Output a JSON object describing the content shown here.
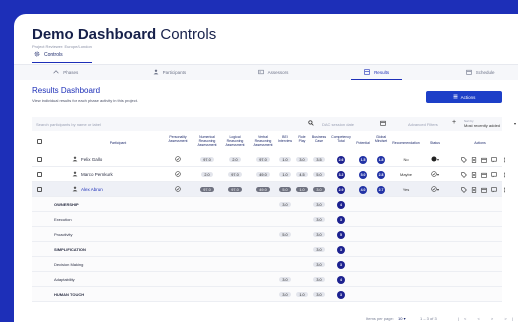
{
  "header": {
    "title": "Demo Dashboard",
    "subtitle": "Controls",
    "project": "Project Reviewer: Europe/London"
  },
  "controls_tab": {
    "label": "Controls",
    "icon": "gear-icon"
  },
  "tabs": [
    {
      "label": "Phases",
      "icon": "phases-icon"
    },
    {
      "label": "Participants",
      "icon": "person-icon"
    },
    {
      "label": "Assessors",
      "icon": "id-card-icon"
    },
    {
      "label": "Results",
      "icon": "results-icon",
      "active": true
    },
    {
      "label": "Schedule",
      "icon": "calendar-icon"
    }
  ],
  "results": {
    "title": "Results Dashboard",
    "description": "View individual results for each phase activity in this project.",
    "actions_label": "Actions"
  },
  "filters": {
    "search_placeholder": "Search participants by name or label",
    "session_placeholder": "DAC session date",
    "advanced_label": "Advanced Filters",
    "sort_label": "Sort by",
    "sort_value": "Most recently added"
  },
  "columns": {
    "participant": "Participant",
    "personality": "Personality Assessment",
    "numerical": "Numerical Reasoning Assessment",
    "logical": "Logical Reasoning Assessment",
    "verbal": "Verbal Reasoning Assessment",
    "bei": "BEI Interview",
    "role": "Role Play",
    "business": "Business Case",
    "competency": "Competency Total",
    "potential": "Potential",
    "global": "Global Mindset",
    "recommendation": "Recommendation",
    "status": "Status",
    "actions": "Actions"
  },
  "participants": [
    {
      "name": "Felix Gallo",
      "numerical": "97.0",
      "logical": "2.0",
      "verbal": "97.0",
      "bei": "1.0",
      "role": "3.0",
      "business": "3.5",
      "competency": "2.6",
      "potential": "1.5",
      "global": "1.8",
      "recommendation": "No"
    },
    {
      "name": "Marco Pernkurk",
      "numerical": "2.0",
      "logical": "97.0",
      "verbal": "49.0",
      "bei": "1.0",
      "role": "4.5",
      "business": "5.0",
      "competency": "3.2",
      "potential": "5.0",
      "global": "2.8",
      "recommendation": "Maybe"
    },
    {
      "name": "Alex Abrun",
      "numerical": "97.0",
      "logical": "97.0",
      "verbal": "49.0",
      "bei": "5.0",
      "role": "1.0",
      "business": "3.0",
      "competency": "2.9",
      "potential": "4.0",
      "global": "2.7",
      "recommendation": "Yes"
    }
  ],
  "subrows": [
    {
      "label": "OWNERSHIP",
      "bold": true,
      "bei": "3.0",
      "role": "",
      "business": "3.0",
      "competency": "4"
    },
    {
      "label": "Execution",
      "bold": false,
      "bei": "",
      "role": "",
      "business": "3.0",
      "competency": "3"
    },
    {
      "label": "Proactivity",
      "bold": false,
      "bei": "5.0",
      "role": "",
      "business": "3.0",
      "competency": "5"
    },
    {
      "label": "SIMPLIFICATION",
      "bold": true,
      "bei": "",
      "role": "",
      "business": "3.0",
      "competency": "3"
    },
    {
      "label": "Decision Making",
      "bold": false,
      "bei": "",
      "role": "",
      "business": "3.0",
      "competency": "3"
    },
    {
      "label": "Adaptability",
      "bold": false,
      "bei": "3.0",
      "role": "",
      "business": "3.0",
      "competency": "4"
    },
    {
      "label": "HUMAN TOUCH",
      "bold": true,
      "bei": "3.0",
      "role": "1.0",
      "business": "3.0",
      "competency": "3"
    }
  ],
  "pager": {
    "items_per_page_label": "Items per page:",
    "items_per_page": "10",
    "range": "1 – 3 of 3"
  },
  "colors": {
    "background": "#1d2fb8",
    "accent": "#1d3fc8",
    "navy": "#1d2290"
  }
}
